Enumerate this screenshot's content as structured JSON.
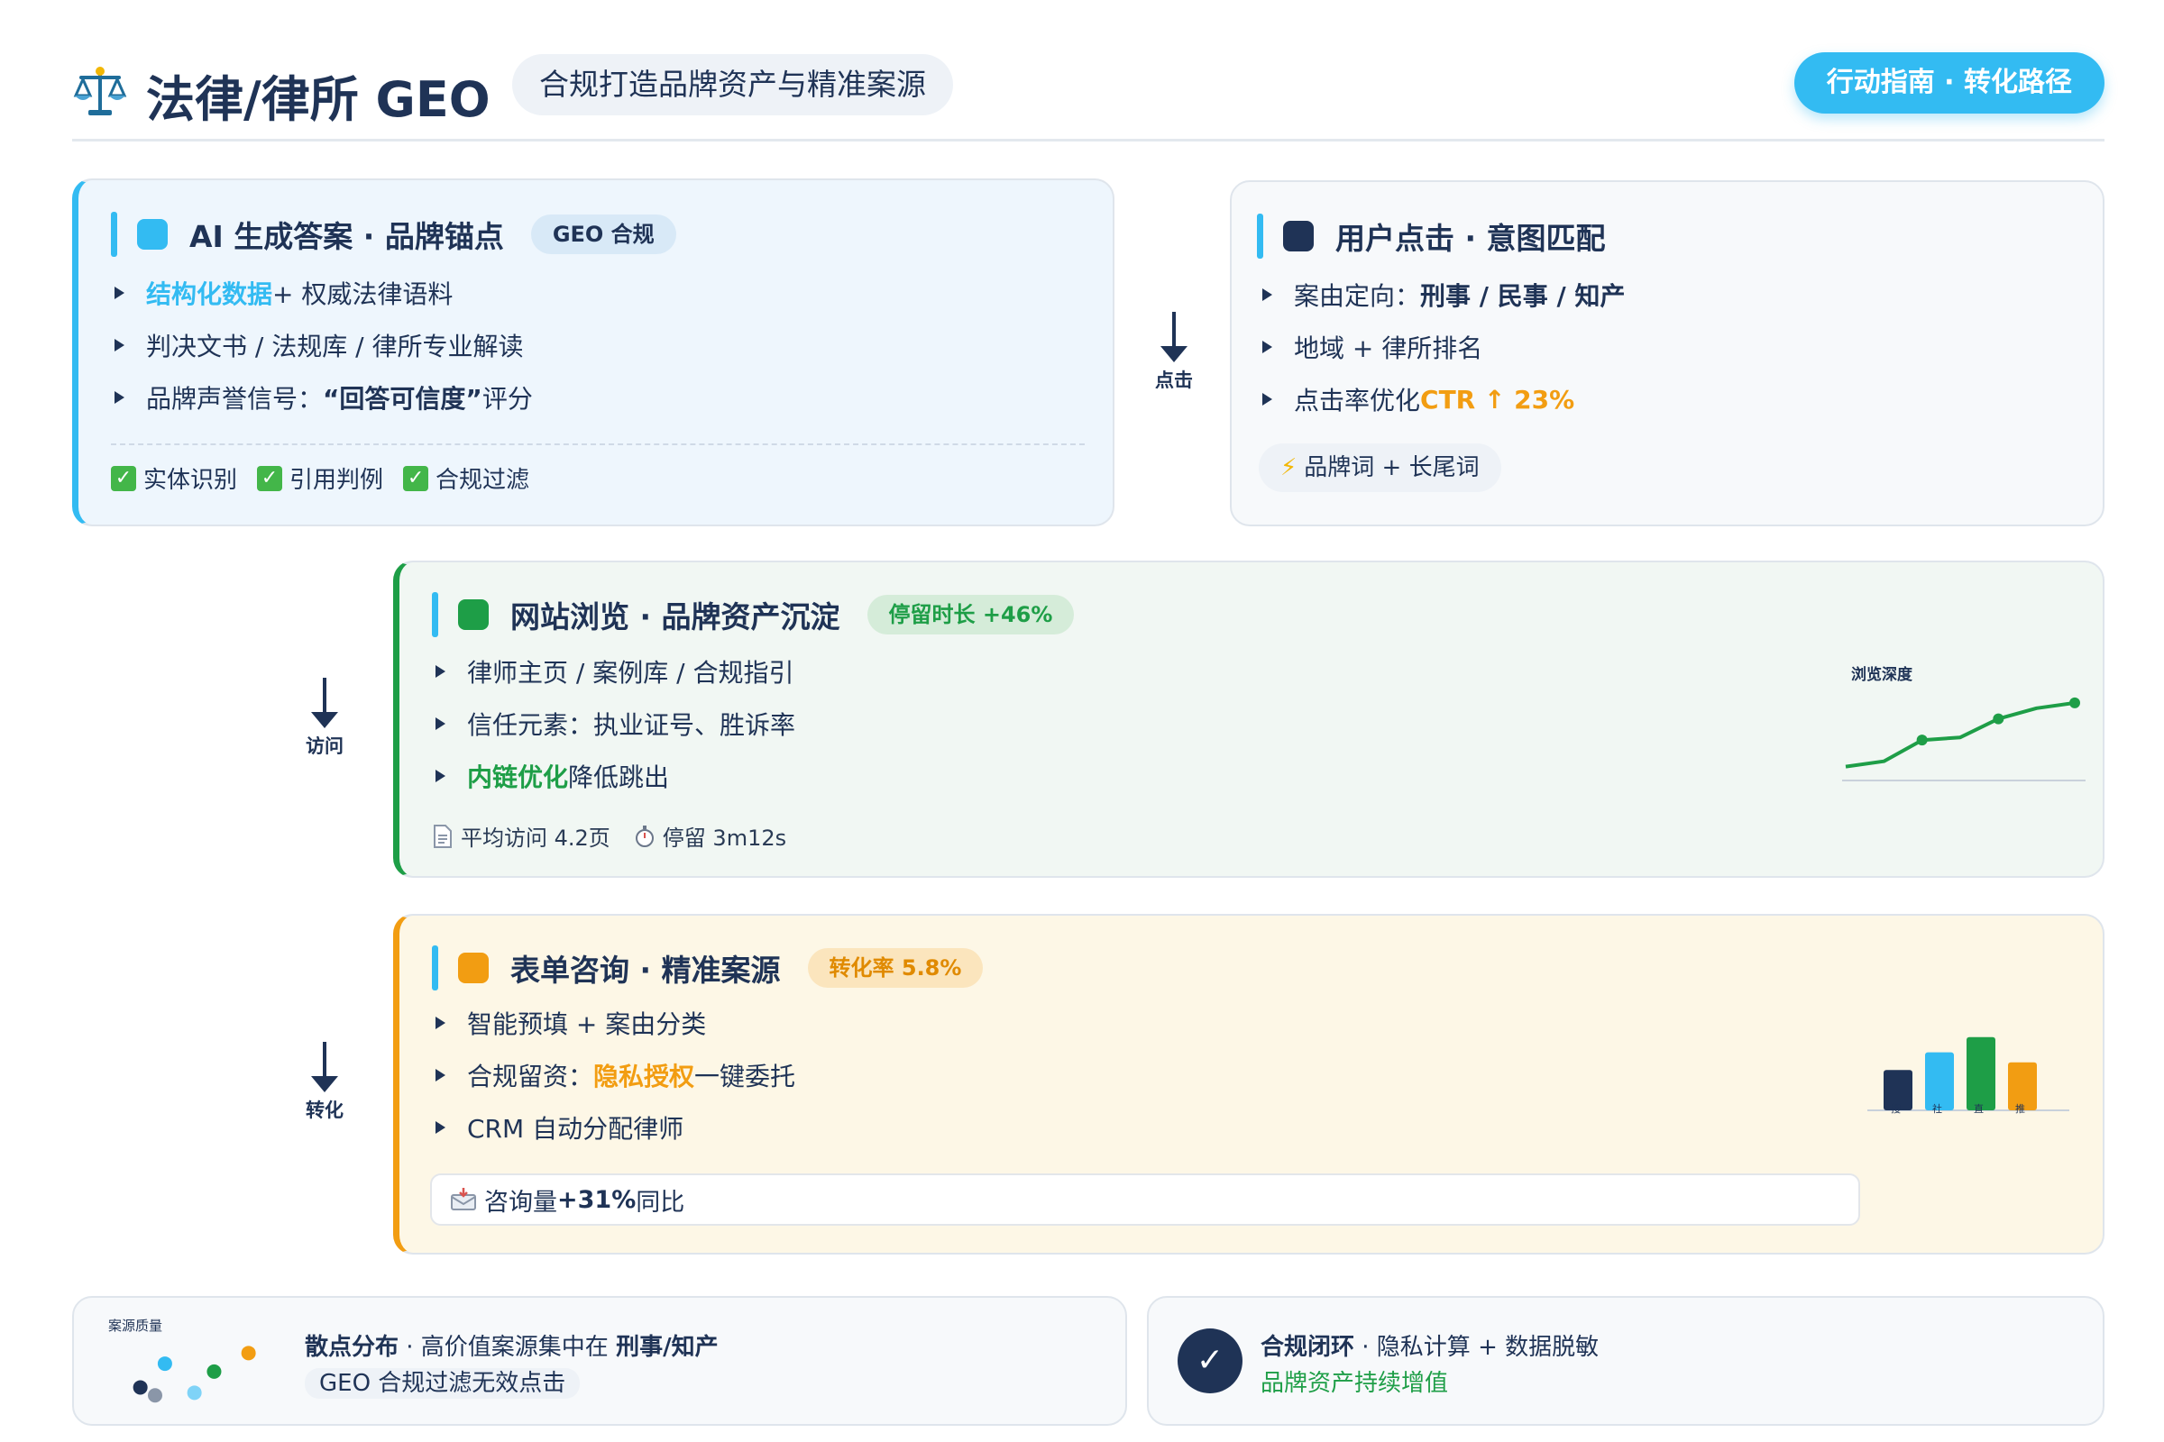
{
  "header": {
    "title": "法律/律所 GEO",
    "subtitle": "合规打造品牌资产与精准案源",
    "action_label": "行动指南 · 转化路径"
  },
  "colors": {
    "navy": "#1f3356",
    "sky": "#33bbf2",
    "green": "#1e9e47",
    "orange": "#f29d12"
  },
  "stage_ai": {
    "title": "AI 生成答案 · 品牌锚点",
    "badge": "GEO 合规",
    "items": [
      {
        "highlight": "结构化数据",
        "text": "+ 权威法律语料"
      },
      {
        "text": "判决文书 / 法规库 / 律所专业解读"
      },
      {
        "text": "品牌声誉信号：",
        "highlight": "“回答可信度”",
        "suffix": " 评分"
      }
    ],
    "checks": [
      "实体识别",
      "引用判例",
      "合规过滤"
    ]
  },
  "stage_click": {
    "title": "用户点击 · 意图匹配",
    "items": [
      {
        "text": "案由定向：",
        "highlight": "刑事 / 民事 / 知产"
      },
      {
        "text": "地域 + 律所排名"
      },
      {
        "text": "点击率优化 ",
        "highlight": "CTR ↑ 23%"
      }
    ],
    "tag": "品牌词 + 长尾词"
  },
  "stage_browse": {
    "title": "网站浏览 · 品牌资产沉淀",
    "badge": "停留时长 +46%",
    "items": [
      {
        "text": "律师主页 / 案例库 / 合规指引"
      },
      {
        "text": "信任元素：执业证号、胜诉率"
      },
      {
        "highlight": "内链优化",
        "text": " 降低跳出"
      }
    ],
    "meta": [
      "平均访问 4.2页",
      "停留 3m12s"
    ]
  },
  "stage_form": {
    "title": "表单咨询 · 精准案源",
    "badge": "转化率 5.8%",
    "items": [
      {
        "text": "智能预填 + 案由分类"
      },
      {
        "text": "合规留资：",
        "highlight": "隐私授权",
        "suffix": " 一键委托"
      },
      {
        "text": "CRM 自动分配律师"
      }
    ],
    "stat": {
      "text": "咨询量 ",
      "highlight": "+31%",
      "suffix": " 同比"
    }
  },
  "arrows": {
    "click": "点击",
    "visit": "访问",
    "convert": "转化"
  },
  "bottom_left": {
    "line1_bold": "散点分布",
    "line1_text": " · 高价值案源集中在 ",
    "line1_bold2": "刑事/知产",
    "line2": "GEO 合规过滤无效点击"
  },
  "bottom_right": {
    "line1_bold": "合规闭环",
    "line1_text": " · 隐私计算 + 数据脱敏",
    "line2": "品牌资产持续增值"
  },
  "chart_data": [
    {
      "type": "line",
      "title": "浏览深度",
      "x": [
        1,
        2,
        3,
        4,
        5,
        6,
        7
      ],
      "values": [
        1.0,
        1.4,
        3.0,
        3.2,
        4.6,
        5.4,
        5.8
      ],
      "color": "#1e9e47",
      "markers": [
        3,
        5,
        7
      ]
    },
    {
      "type": "bar",
      "categories": [
        "搜",
        "社",
        "直",
        "推"
      ],
      "values": [
        3.2,
        4.6,
        5.8,
        3.8
      ],
      "colors": [
        "#1f3356",
        "#33bbf2",
        "#1e9e47",
        "#f29d12"
      ]
    },
    {
      "type": "scatter",
      "title": "案源质量",
      "points": [
        {
          "x": 2.0,
          "y": 4.2,
          "color": "#33bbf2"
        },
        {
          "x": 4.0,
          "y": 3.6,
          "color": "#1e9e47"
        },
        {
          "x": 5.4,
          "y": 5.0,
          "color": "#f29d12"
        },
        {
          "x": 1.0,
          "y": 2.4,
          "color": "#1f3356"
        },
        {
          "x": 1.6,
          "y": 1.8,
          "color": "#8a96a8"
        },
        {
          "x": 3.2,
          "y": 2.0,
          "color": "#7fd3f7"
        }
      ]
    }
  ]
}
